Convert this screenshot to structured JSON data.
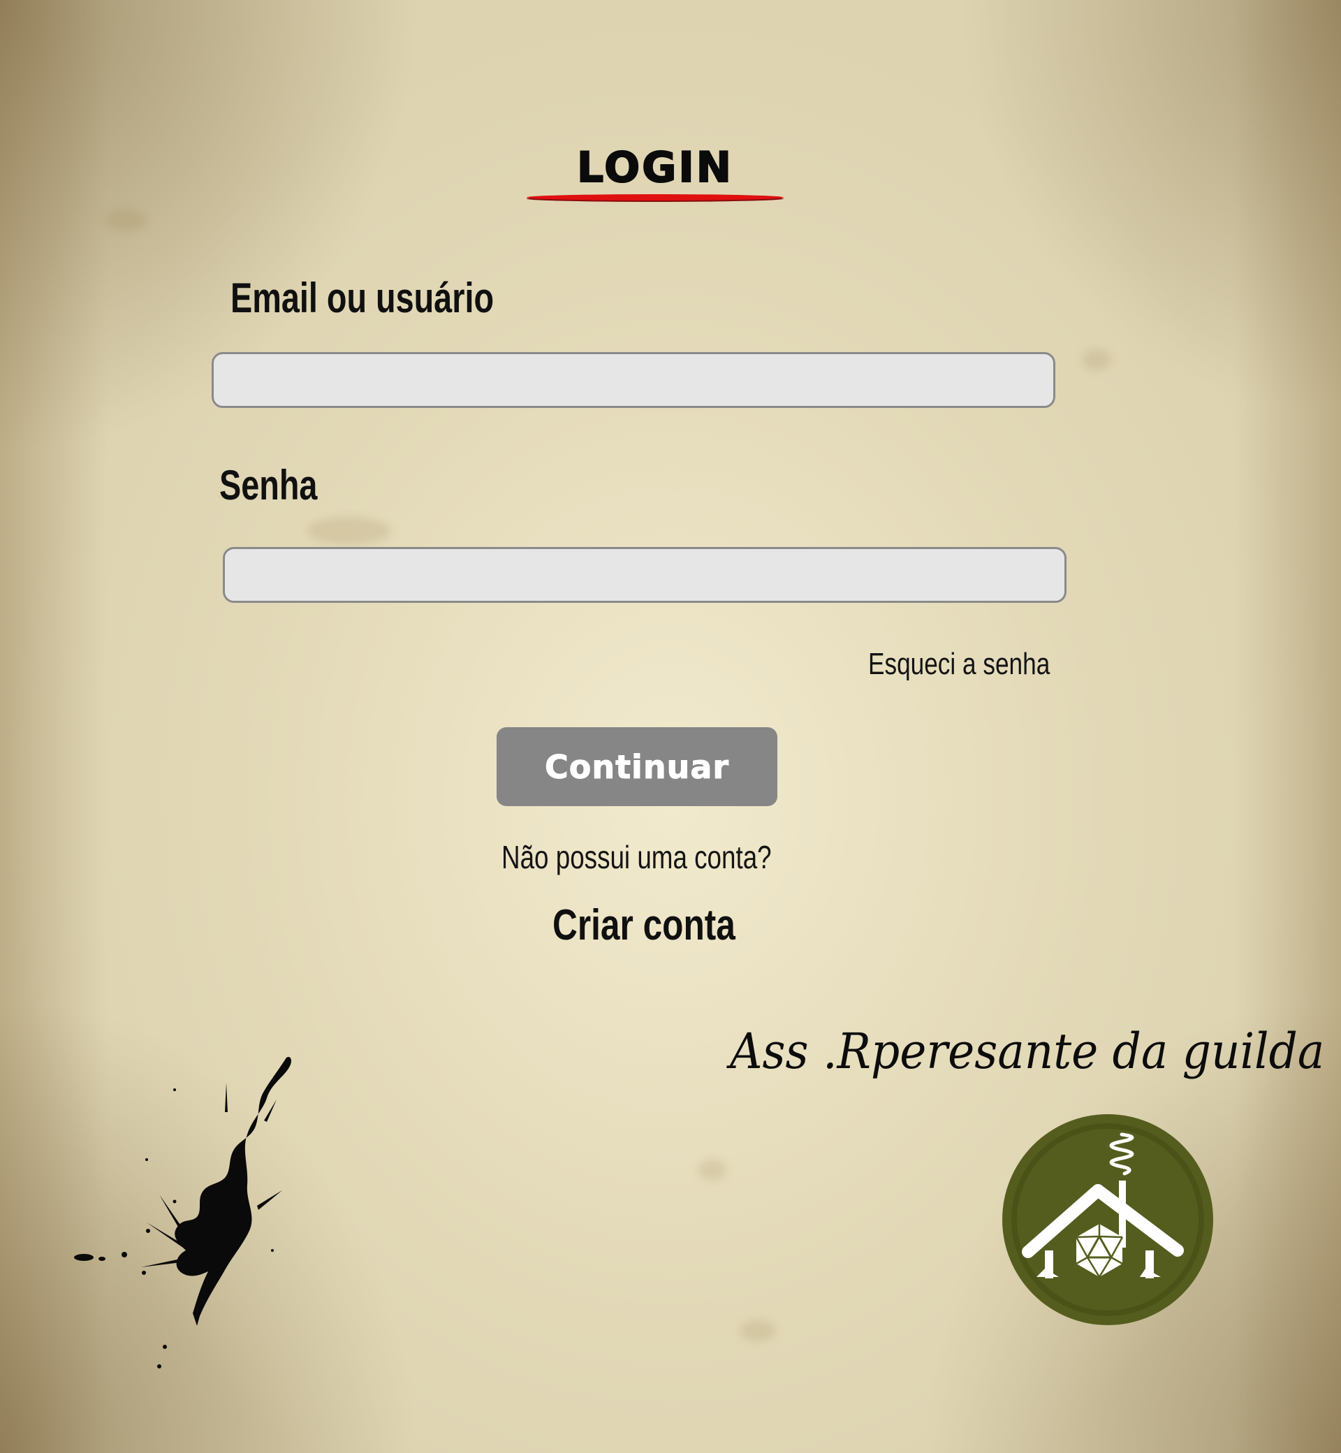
{
  "page": {
    "background_color": "#ddd3b1"
  },
  "header": {
    "title": "LOGIN",
    "underline_color": "#e01010"
  },
  "form": {
    "email": {
      "label": "Email ou usuário",
      "value": "",
      "placeholder": ""
    },
    "password": {
      "label": "Senha",
      "value": "",
      "placeholder": ""
    },
    "forgot_password_link": "Esqueci a senha",
    "continue_button": {
      "label": "Continuar",
      "color": "#868686"
    }
  },
  "signup": {
    "prompt": "Não possui uma conta?",
    "create_account_link": "Criar conta"
  },
  "footer": {
    "signature": "Ass .Rperesante da guilda",
    "logo": {
      "icon": "guild-house-d20-logo-icon",
      "color": "#555d1e"
    },
    "decoration": {
      "icon": "ink-splatter-icon"
    }
  }
}
